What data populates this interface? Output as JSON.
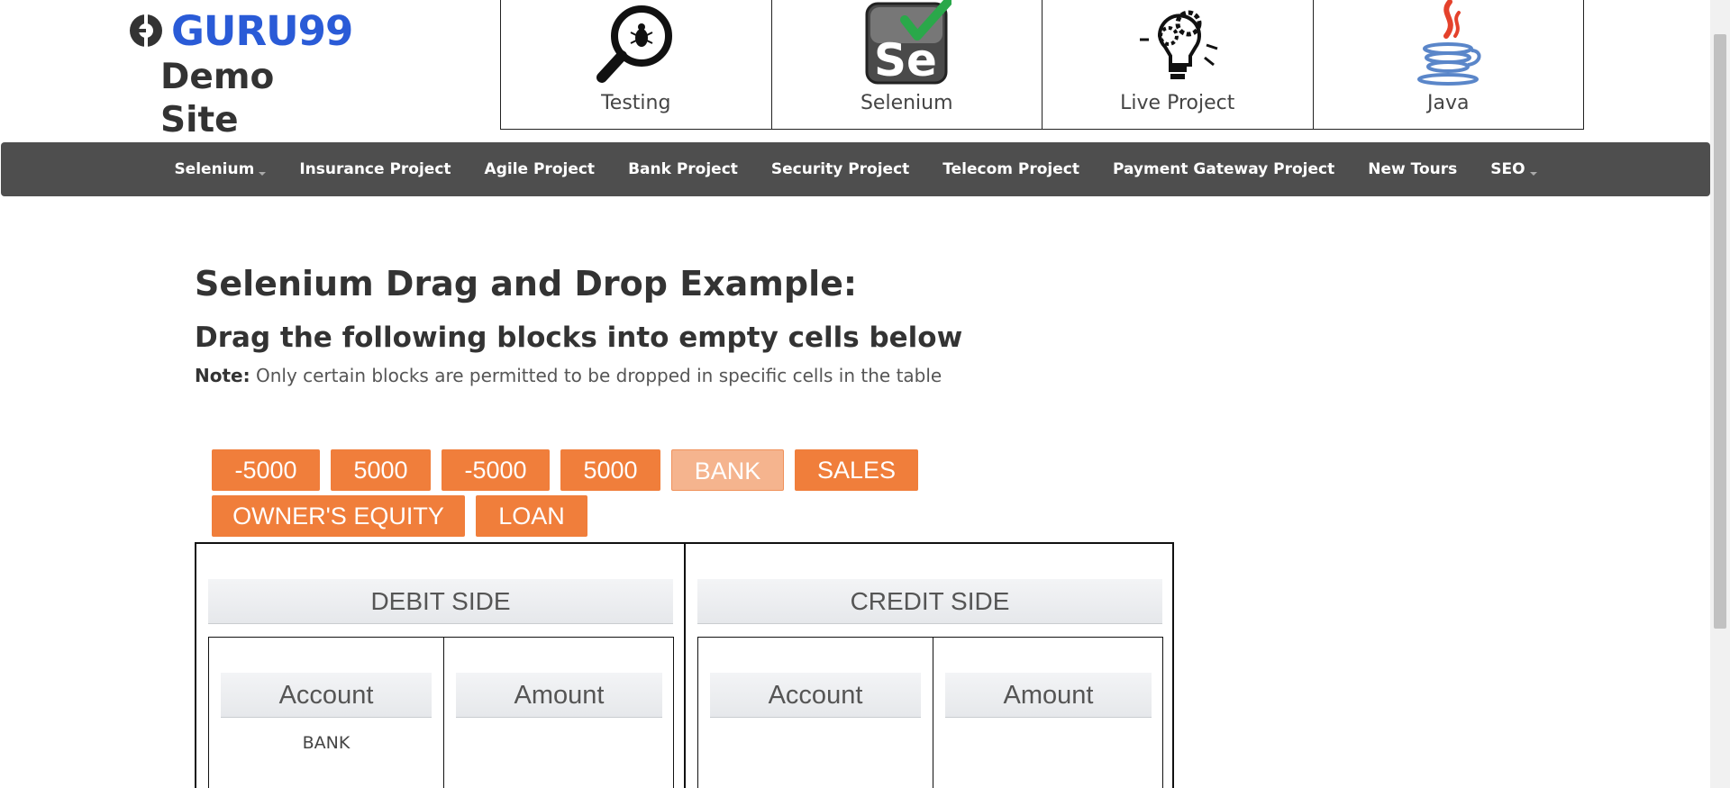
{
  "logo": {
    "word": "GURU99",
    "subtitle": "Demo Site"
  },
  "tiles": [
    {
      "label": "Testing",
      "icon": "magnifier-bug-icon"
    },
    {
      "label": "Selenium",
      "icon": "selenium-logo-icon"
    },
    {
      "label": "Live Project",
      "icon": "lightbulb-gears-icon"
    },
    {
      "label": "Java",
      "icon": "java-cup-icon"
    }
  ],
  "nav": {
    "items": [
      {
        "label": "Selenium",
        "dropdown": true
      },
      {
        "label": "Insurance Project"
      },
      {
        "label": "Agile Project"
      },
      {
        "label": "Bank Project"
      },
      {
        "label": "Security Project"
      },
      {
        "label": "Telecom Project"
      },
      {
        "label": "Payment Gateway Project"
      },
      {
        "label": "New Tours"
      },
      {
        "label": "SEO",
        "dropdown": true
      }
    ]
  },
  "main": {
    "title": "Selenium Drag and Drop Example:",
    "subtitle": "Drag the following blocks into empty cells below",
    "note_label": "Note:",
    "note_text": " Only certain blocks are permitted to be dropped in specific cells in the table"
  },
  "blocks": {
    "row1": [
      "-5000",
      "5000",
      "-5000",
      "5000",
      "BANK",
      "SALES"
    ],
    "row2": [
      "OWNER'S EQUITY",
      "LOAN"
    ]
  },
  "table": {
    "debit_title": "DEBIT SIDE",
    "credit_title": "CREDIT SIDE",
    "account_label": "Account",
    "amount_label": "Amount",
    "debit_account_value": "BANK"
  },
  "colors": {
    "accent": "#f07e3b",
    "faded_block": "#f5b48e",
    "nav_bg": "#4e4e4e",
    "logo_blue": "#2a5bd7"
  }
}
